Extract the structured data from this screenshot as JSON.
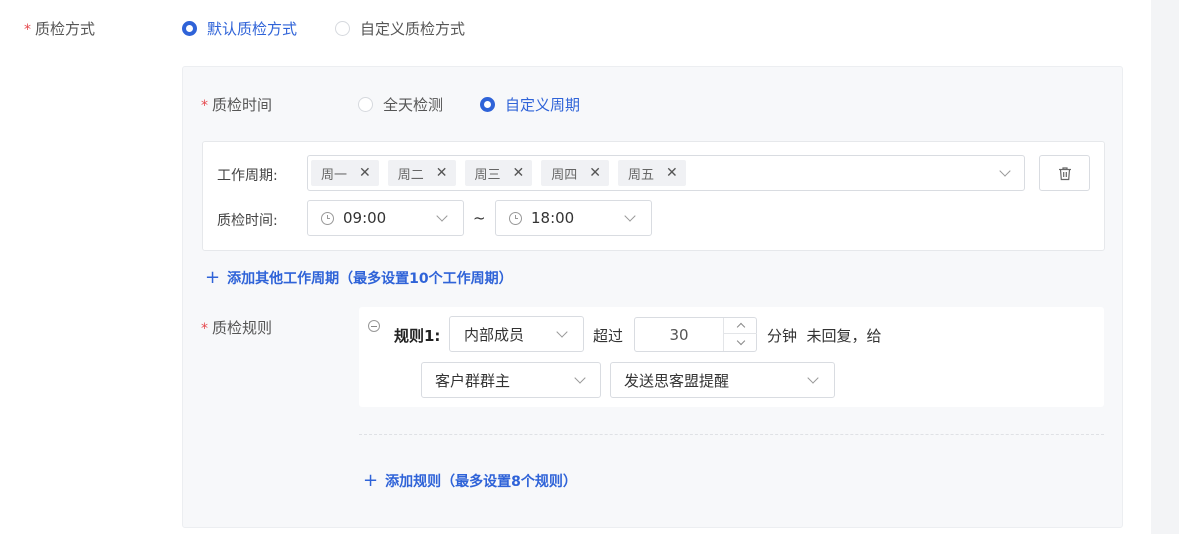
{
  "form": {
    "method": {
      "label": "质检方式",
      "options": [
        {
          "label": "默认质检方式",
          "checked": true
        },
        {
          "label": "自定义质检方式",
          "checked": false
        }
      ]
    },
    "time": {
      "label": "质检时间",
      "options": [
        {
          "label": "全天检测",
          "checked": false
        },
        {
          "label": "自定义周期",
          "checked": true
        }
      ]
    },
    "period": {
      "work_cycle_label": "工作周期:",
      "days": [
        "周一",
        "周二",
        "周三",
        "周四",
        "周五"
      ],
      "tag_close": "✕",
      "check_time_label": "质检时间:",
      "start_time": "09:00",
      "separator": "~",
      "end_time": "18:00"
    },
    "add_period_link": "添加其他工作周期（最多设置10个工作周期）",
    "rules": {
      "label": "质检规则",
      "items": [
        {
          "name": "规则1:",
          "member": "内部成员",
          "exceed_label": "超过",
          "minutes": "30",
          "after_text": "分钟  未回复，给",
          "target": "客户群群主",
          "action": "发送思客盟提醒"
        }
      ]
    },
    "add_rule_link": "添加规则（最多设置8个规则）"
  },
  "colors": {
    "accent": "#2f63d8",
    "required": "#e5484d",
    "panel_bg": "#f7f8fa"
  },
  "icons": {
    "plus": "+",
    "trash": "trash-icon",
    "clock": "clock-icon",
    "remove": "minus-circle-icon"
  }
}
